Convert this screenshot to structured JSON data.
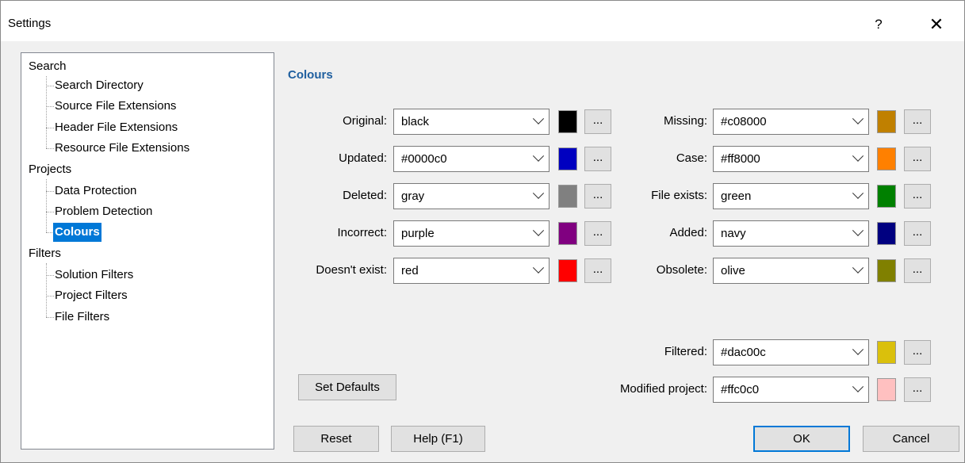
{
  "window": {
    "title": "Settings",
    "help_glyph": "?",
    "close_glyph": "✕"
  },
  "tree": {
    "search": {
      "label": "Search",
      "items": [
        "Search Directory",
        "Source File Extensions",
        "Header File Extensions",
        "Resource File Extensions"
      ]
    },
    "projects": {
      "label": "Projects",
      "items": [
        "Data Protection",
        "Problem Detection",
        "Colours"
      ],
      "selected": "Colours"
    },
    "filters": {
      "label": "Filters",
      "items": [
        "Solution Filters",
        "Project Filters",
        "File Filters"
      ]
    }
  },
  "section_title": "Colours",
  "left_colours": [
    {
      "label": "Original:",
      "value": "black",
      "color": "#000000"
    },
    {
      "label": "Updated:",
      "value": "#0000c0",
      "color": "#0000c0"
    },
    {
      "label": "Deleted:",
      "value": "gray",
      "color": "#808080"
    },
    {
      "label": "Incorrect:",
      "value": "purple",
      "color": "#800080"
    },
    {
      "label": "Doesn't exist:",
      "value": "red",
      "color": "#ff0000"
    }
  ],
  "right_colours": [
    {
      "label": "Missing:",
      "value": "#c08000",
      "color": "#c08000"
    },
    {
      "label": "Case:",
      "value": "#ff8000",
      "color": "#ff8000"
    },
    {
      "label": "File exists:",
      "value": "green",
      "color": "#008000"
    },
    {
      "label": "Added:",
      "value": "navy",
      "color": "#000080"
    },
    {
      "label": "Obsolete:",
      "value": "olive",
      "color": "#808000"
    }
  ],
  "extra_colours": [
    {
      "label": "Filtered:",
      "value": "#dac00c",
      "color": "#dac00c"
    },
    {
      "label": "Modified project:",
      "value": "#ffc0c0",
      "color": "#ffc0c0"
    }
  ],
  "dots_label": "...",
  "buttons": {
    "set_defaults": "Set Defaults",
    "reset": "Reset",
    "help": "Help (F1)",
    "ok": "OK",
    "cancel": "Cancel"
  }
}
